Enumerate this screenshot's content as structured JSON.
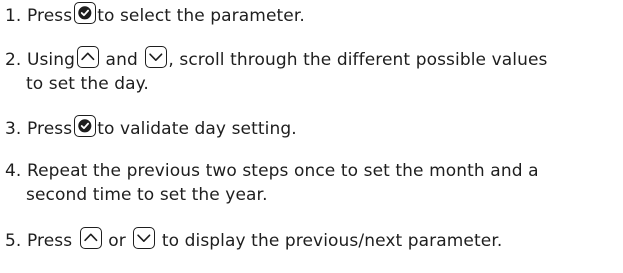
{
  "steps": [
    {
      "number": "1.",
      "parts": [
        "Press",
        "to select the parameter."
      ]
    },
    {
      "number": "2.",
      "parts": [
        "Using",
        "and",
        ", scroll through the different possible values",
        "to set the day."
      ]
    },
    {
      "number": "3.",
      "parts": [
        "Press",
        "to validate day setting."
      ]
    },
    {
      "number": "4.",
      "parts": [
        "Repeat the previous two steps once to set the month and a",
        "second time to set the year."
      ]
    },
    {
      "number": "5.",
      "parts": [
        "Press",
        "or",
        "to display the previous/next parameter."
      ]
    }
  ],
  "icons": {
    "confirm": "check-circle-icon",
    "up": "chevron-up-icon",
    "down": "chevron-down-icon"
  },
  "colors": {
    "text": "#1e1e1e",
    "icon_fill": "#1e1e1e"
  }
}
